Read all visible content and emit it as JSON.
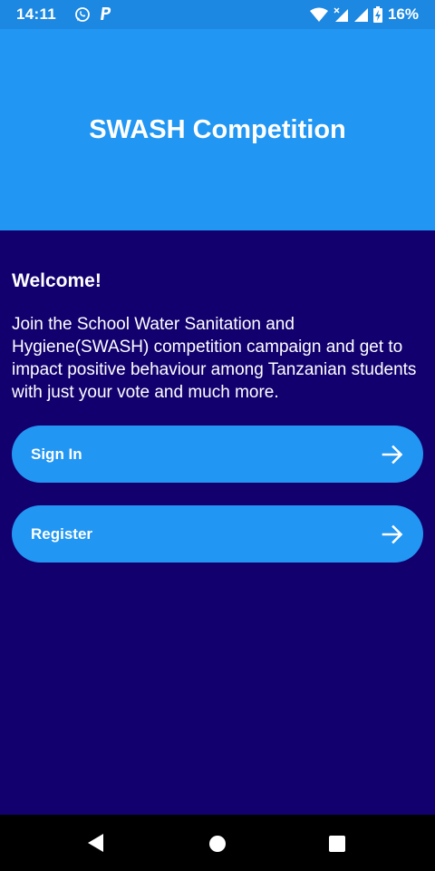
{
  "status_bar": {
    "time": "14:11",
    "left_icons": [
      "whatsapp-icon",
      "paypal-icon"
    ],
    "right_icons": [
      "wifi-icon",
      "signal-x-icon",
      "signal-icon",
      "battery-charging-icon"
    ],
    "battery": "16%"
  },
  "header": {
    "title": "SWASH Competition"
  },
  "main": {
    "welcome": "Welcome!",
    "description": "Join the School Water Sanitation and Hygiene(SWASH) competition campaign and get to impact positive behaviour among Tanzanian students with just your vote and much more.",
    "buttons": [
      {
        "label": "Sign In",
        "icon": "arrow-right-icon"
      },
      {
        "label": "Register",
        "icon": "arrow-right-icon"
      }
    ]
  },
  "nav_bar": {
    "buttons": [
      "back-icon",
      "home-icon",
      "recents-icon"
    ]
  },
  "colors": {
    "status_bar": "#1c88e1",
    "header": "#2196f3",
    "background": "#13006f",
    "button": "#2196f3",
    "nav_bar": "#000000"
  }
}
